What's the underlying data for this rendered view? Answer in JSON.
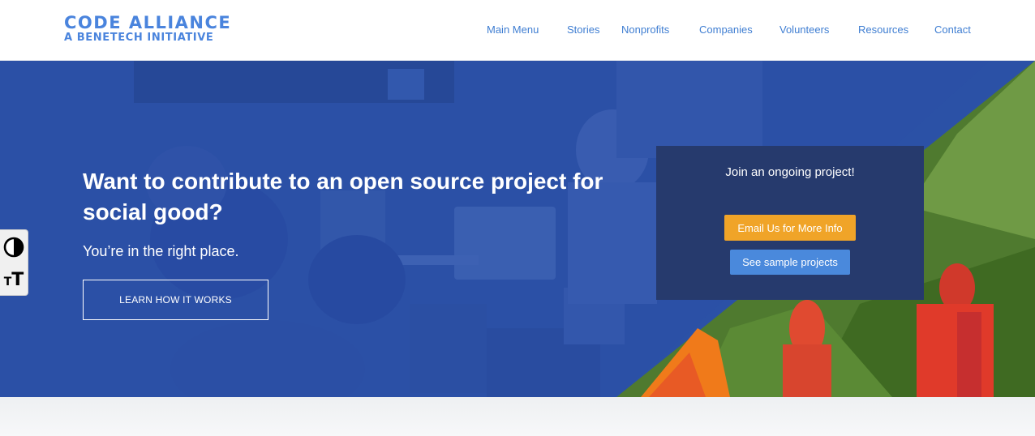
{
  "header": {
    "logo": {
      "line1": "CODE ALLIANCE",
      "line2": "A BENETECH INITIATIVE"
    },
    "nav": [
      {
        "label": "Main Menu"
      },
      {
        "label": "Stories"
      },
      {
        "label": "Nonprofits"
      },
      {
        "label": "Companies"
      },
      {
        "label": "Volunteers"
      },
      {
        "label": "Resources"
      },
      {
        "label": "Contact"
      }
    ]
  },
  "hero": {
    "title": "Want to contribute to an open source project for social good?",
    "subtitle": "You’re in the right place.",
    "cta_label": "LEARN HOW IT WORKS",
    "join_box": {
      "title": "Join an ongoing project!",
      "email_button": "Email Us for More Info",
      "sample_button": "See sample projects"
    }
  },
  "accessibility": {
    "contrast_icon": "contrast-icon",
    "text_size_icon": "text-size-icon"
  },
  "colors": {
    "brand": "#4a84dd",
    "nav_link": "#3f7ed2",
    "hero_overlay": "#2b51a6",
    "join_box": "#263a6d",
    "email_button": "#f0a428",
    "sample_button": "#4a89dc"
  }
}
